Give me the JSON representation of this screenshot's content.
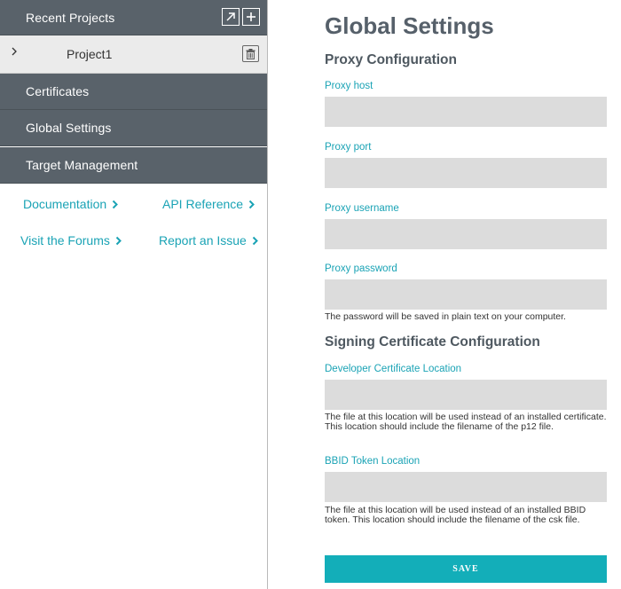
{
  "sidebar": {
    "recent_projects_label": "Recent Projects",
    "project": {
      "name": "Project1"
    },
    "nav": {
      "certificates": "Certificates",
      "global_settings": "Global Settings",
      "target_management": "Target Management"
    },
    "links": {
      "documentation": "Documentation",
      "api_reference": "API Reference",
      "visit_forums": "Visit the Forums",
      "report_issue": "Report an Issue"
    }
  },
  "main": {
    "title": "Global Settings",
    "proxy_section": "Proxy Configuration",
    "signing_section": "Signing Certificate Configuration",
    "fields": {
      "proxy_host": {
        "label": "Proxy host",
        "value": ""
      },
      "proxy_port": {
        "label": "Proxy port",
        "value": ""
      },
      "proxy_username": {
        "label": "Proxy username",
        "value": ""
      },
      "proxy_password": {
        "label": "Proxy password",
        "value": "",
        "help": "The password will be saved in plain text on your computer."
      },
      "dev_cert_location": {
        "label": "Developer Certificate Location",
        "value": "",
        "help": "The file at this location will be used instead of an installed certificate. This location should include the filename of the p12 file."
      },
      "bbid_token_location": {
        "label": "BBID Token Location",
        "value": "",
        "help": "The file at this location will be used instead of an installed BBID token. This location should include the filename of the csk file."
      }
    },
    "save_label": "SAVE"
  },
  "icons": {
    "open": "external-link-icon",
    "add": "plus-icon",
    "delete": "trash-icon",
    "expand": "chevron-right-icon",
    "link": "chevron-right-icon"
  },
  "colors": {
    "sidebar_nav": "#59626a",
    "accent": "#1aa3b5",
    "save_button": "#13aeb9",
    "input_bg": "#dcdcdc"
  }
}
